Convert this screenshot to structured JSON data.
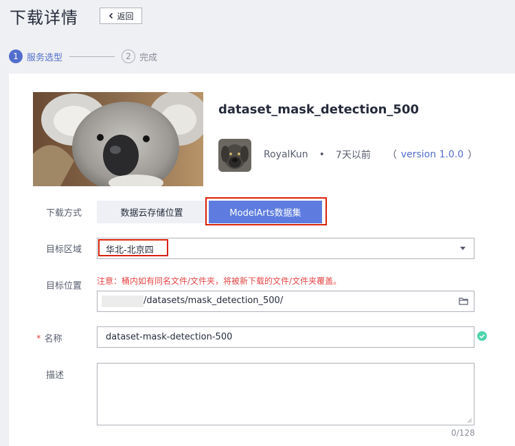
{
  "header": {
    "title": "下载详情",
    "back_label": "返回"
  },
  "steps": [
    {
      "number": "1",
      "label": "服务选型",
      "active": true
    },
    {
      "number": "2",
      "label": "完成",
      "active": false
    }
  ],
  "dataset": {
    "name": "dataset_mask_detection_500",
    "author": "RoyalKun",
    "separator": "•",
    "published": "7天以前",
    "version_open": "（",
    "version": "version 1.0.0",
    "version_close": "）"
  },
  "form": {
    "download_method": {
      "label": "下载方式",
      "options": [
        "数据云存储位置",
        "ModelArts数据集"
      ],
      "selected": "ModelArts数据集"
    },
    "target_region": {
      "label": "目标区域",
      "value": "华北-北京四"
    },
    "target_location": {
      "label": "目标位置",
      "warning": "注意：桶内如有同名文件/文件夹，将被新下载的文件/文件夹覆盖。",
      "path": "/datasets/mask_detection_500/"
    },
    "name": {
      "required_mark": "*",
      "label": "名称",
      "value": "dataset-mask-detection-500"
    },
    "description": {
      "label": "描述",
      "value": "",
      "counter": "0/128"
    }
  },
  "colors": {
    "accent": "#526ecc",
    "highlight": "#d81e06",
    "error": "#e54545",
    "success": "#50d4ab"
  }
}
